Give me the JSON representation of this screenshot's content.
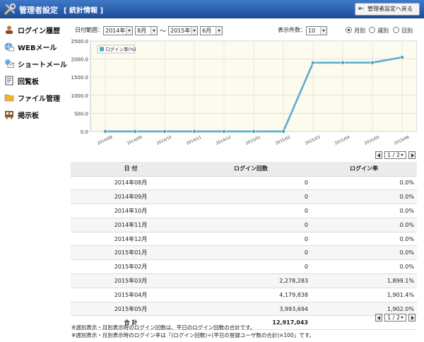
{
  "header": {
    "title": "管理者設定",
    "subtitle": "[ 統計情報 ]",
    "back_label": "管理者設定へ戻る"
  },
  "sidebar": {
    "items": [
      {
        "label": "ログイン履歴",
        "icon": "user-history-icon"
      },
      {
        "label": "WEBメール",
        "icon": "globe-mail-icon"
      },
      {
        "label": "ショートメール",
        "icon": "short-mail-icon"
      },
      {
        "label": "回覧板",
        "icon": "circular-board-icon"
      },
      {
        "label": "ファイル管理",
        "icon": "folder-icon"
      },
      {
        "label": "掲示板",
        "icon": "bulletin-board-icon"
      }
    ]
  },
  "filters": {
    "range_label": "日付範囲：",
    "from_year": "2014年",
    "from_month": "8月",
    "tilde": "～",
    "to_year": "2015年",
    "to_month": "6月",
    "count_label": "表示件数：",
    "count_value": "10",
    "radios": [
      {
        "label": "月別",
        "checked": true
      },
      {
        "label": "週別",
        "checked": false
      },
      {
        "label": "日別",
        "checked": false
      }
    ]
  },
  "chart_data": {
    "type": "line",
    "categories": [
      "2014/08",
      "2014/09",
      "2014/10",
      "2014/11",
      "2014/12",
      "2015/01",
      "2015/02",
      "2015/03",
      "2015/04",
      "2015/05",
      "2015/06"
    ],
    "series": [
      {
        "name": "ログイン率(%)",
        "values": [
          0,
          0,
          0,
          0,
          0,
          0,
          0,
          1899.1,
          1901.4,
          1902.0,
          2050
        ],
        "color": "#4aa8c4"
      }
    ],
    "ylim": [
      0,
      2500
    ],
    "yticks": [
      "0.0",
      "500.0",
      "1000.0",
      "1500.0",
      "2000.0",
      "2500.0"
    ],
    "grid": true,
    "legend": "top-left"
  },
  "pager": {
    "value": "1 / 2"
  },
  "table": {
    "headers": [
      "日 付",
      "ログイン回数",
      "ログイン率"
    ],
    "rows": [
      [
        "2014年08月",
        "0",
        "0.0%"
      ],
      [
        "2014年09月",
        "0",
        "0.0%"
      ],
      [
        "2014年10月",
        "0",
        "0.0%"
      ],
      [
        "2014年11月",
        "0",
        "0.0%"
      ],
      [
        "2014年12月",
        "0",
        "0.0%"
      ],
      [
        "2015年01月",
        "0",
        "0.0%"
      ],
      [
        "2015年02月",
        "0",
        "0.0%"
      ],
      [
        "2015年03月",
        "2,278,283",
        "1,899.1%"
      ],
      [
        "2015年04月",
        "4,179,838",
        "1,901.4%"
      ],
      [
        "2015年05月",
        "3,993,694",
        "1,902.0%"
      ]
    ],
    "total": {
      "label": "合 計",
      "value": "12,917,043"
    }
  },
  "notes": [
    "※週別表示・月別表示時のログイン回数は、平日のログイン回数の合計です。",
    "※週別表示・月別表示時のログイン率は「(ログイン回数)÷(平日の登録ユーザ数の合計)×100」です。"
  ]
}
